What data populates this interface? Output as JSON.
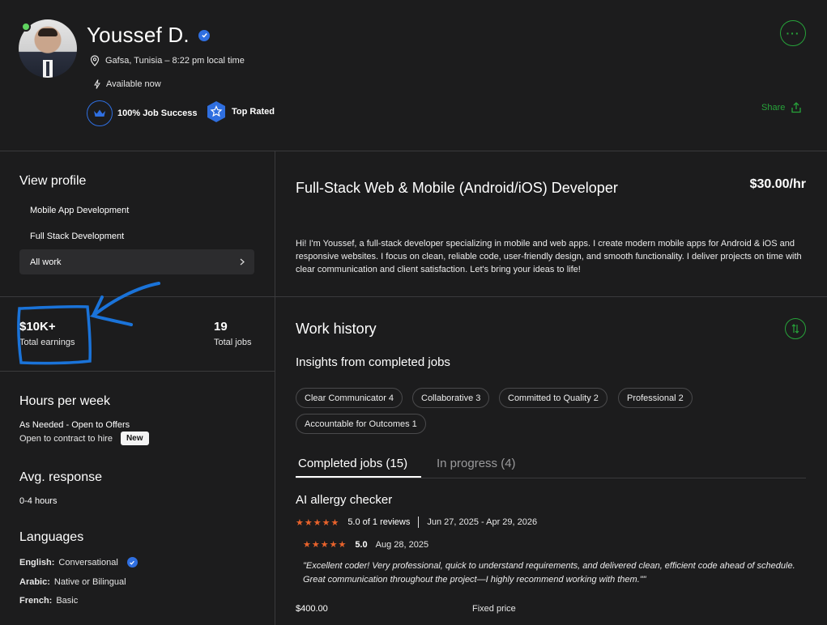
{
  "header": {
    "name": "Youssef D.",
    "location": "Gafsa, Tunisia – 8:22 pm local time",
    "availability": "Available now",
    "job_success": "100% Job Success",
    "top_rated": "Top Rated",
    "share_label": "Share",
    "more_label": "···"
  },
  "sidebar": {
    "view_profile": "View profile",
    "items": [
      {
        "label": "Mobile App Development"
      },
      {
        "label": "Full Stack Development"
      },
      {
        "label": "All work"
      }
    ],
    "stats": {
      "earnings_value": "$10K+",
      "earnings_label": "Total earnings",
      "jobs_value": "19",
      "jobs_label": "Total jobs"
    },
    "hours": {
      "title": "Hours per week",
      "value": "As Needed - Open to Offers",
      "contract": "Open to contract to hire",
      "new_badge": "New"
    },
    "response": {
      "title": "Avg. response",
      "value": "0-4 hours"
    },
    "languages": {
      "title": "Languages",
      "items": [
        {
          "name": "English:",
          "level": "Conversational"
        },
        {
          "name": "Arabic:",
          "level": "Native or Bilingual"
        },
        {
          "name": "French:",
          "level": "Basic"
        }
      ]
    }
  },
  "main": {
    "title": "Full-Stack Web & Mobile (Android/iOS) Developer",
    "rate": "$30.00/hr",
    "bio": "Hi! I'm Youssef, a full-stack developer specializing in mobile and web apps. I create modern mobile apps for Android & iOS and responsive websites. I focus on clean, reliable code, user-friendly design, and smooth functionality. I deliver projects on time with clear communication and client satisfaction. Let's bring your ideas to life!",
    "work_history": "Work history",
    "insights_title": "Insights from completed jobs",
    "chips": [
      "Clear Communicator 4",
      "Collaborative 3",
      "Committed to Quality 2",
      "Professional 2",
      "Accountable for Outcomes 1"
    ],
    "tabs": [
      "Completed jobs (15)",
      "In progress (4)"
    ],
    "job": {
      "title": "AI allergy checker",
      "stars": "★★★★★",
      "rating_summary": "5.0 of 1 reviews",
      "date_range": "Jun 27, 2025 - Apr 29, 2026",
      "review_stars": "★★★★★",
      "review_score": "5.0",
      "review_date": "Aug 28, 2025",
      "review_text": "\"Excellent coder! Very professional, quick to understand requirements, and delivered clean, efficient code ahead of schedule. Great communication throughout the project—I highly recommend working with them.\"\"",
      "price": "$400.00",
      "price_type": "Fixed price"
    }
  },
  "colors": {
    "background": "#1c1c1d",
    "accent_green": "#27a33a",
    "badge_blue": "#2f6fe0",
    "star_orange": "#e9632c",
    "annotation_blue": "#1a73d9"
  },
  "icons": [
    "location-pin-icon",
    "lightning-icon",
    "crown-icon",
    "star-badge-icon",
    "verified-icon",
    "share-icon",
    "chevron-right-icon",
    "sort-icon"
  ]
}
